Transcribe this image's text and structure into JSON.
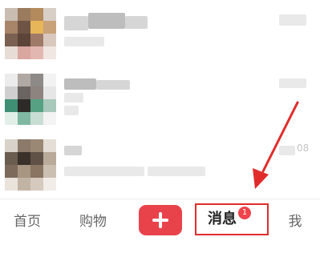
{
  "tabbar": {
    "home_label": "首页",
    "shop_label": "购物",
    "post_icon": "plus-icon",
    "messages_label": "消息",
    "messages_badge": "1",
    "me_label": "我",
    "accent_color": "#e8434b"
  },
  "list": {
    "row3_time_fragment": "08"
  },
  "annotation": {
    "color": "#e12b2b",
    "type": "arrow-and-box"
  }
}
